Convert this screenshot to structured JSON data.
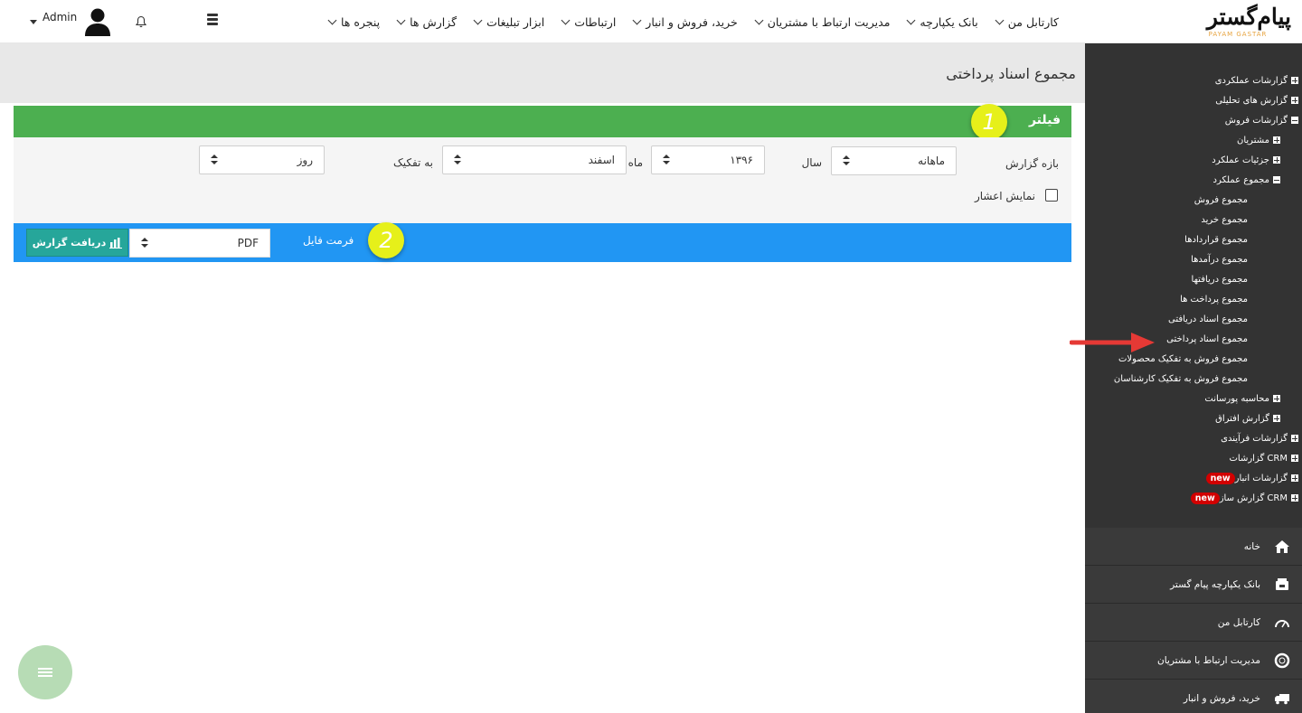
{
  "logo": {
    "main": "پیام‌گستر",
    "sub": "PAYAM GASTAR"
  },
  "nav": [
    {
      "label": "کارتابل من"
    },
    {
      "label": "بانک یکپارچه"
    },
    {
      "label": "مدیریت ارتباط با مشتریان"
    },
    {
      "label": "خرید، فروش و انبار"
    },
    {
      "label": "ارتباطات"
    },
    {
      "label": "ابزار تبلیغات"
    },
    {
      "label": "گزارش ها"
    },
    {
      "label": "پنجره ها"
    }
  ],
  "user": {
    "name": "Admin"
  },
  "page": {
    "title": "مجموع اسناد پرداختی"
  },
  "filter": {
    "title": "فیلتر",
    "callout": "1",
    "period_label": "بازه گزارش",
    "period_value": "ماهانه",
    "year_label": "سال",
    "year_value": "۱۳۹۶",
    "month_label": "ماه",
    "month_value": "اسفند",
    "breakdown_label": "به تفکیک",
    "breakdown_value": "روز",
    "decimals_label": "نمایش اعشار"
  },
  "export": {
    "callout": "2",
    "format_label": "فرمت فایل",
    "format_value": "PDF",
    "download_label": "دریافت گزارش"
  },
  "tree": [
    {
      "label": "گزارشات عملکردی",
      "indent": 0,
      "icon": "plus"
    },
    {
      "label": "گزارش های تحلیلی",
      "indent": 0,
      "icon": "plus"
    },
    {
      "label": "گزارشات فروش",
      "indent": 0,
      "icon": "minus"
    },
    {
      "label": "مشتریان",
      "indent": 1,
      "icon": "plus"
    },
    {
      "label": "جزئیات عملکرد",
      "indent": 1,
      "icon": "plus"
    },
    {
      "label": "مجموع عملکرد",
      "indent": 1,
      "icon": "minus"
    },
    {
      "label": "مجموع فروش",
      "indent": 2,
      "icon": "none"
    },
    {
      "label": "مجموع خرید",
      "indent": 2,
      "icon": "none"
    },
    {
      "label": "مجموع قراردادها",
      "indent": 2,
      "icon": "none"
    },
    {
      "label": "مجموع درآمدها",
      "indent": 2,
      "icon": "none"
    },
    {
      "label": "مجموع دریافتها",
      "indent": 2,
      "icon": "none"
    },
    {
      "label": "مجموع پرداخت ها",
      "indent": 2,
      "icon": "none"
    },
    {
      "label": "مجموع اسناد دریافتی",
      "indent": 2,
      "icon": "none"
    },
    {
      "label": "مجموع اسناد پرداختی",
      "indent": 2,
      "icon": "none"
    },
    {
      "label": "مجموع فروش به تفکیک محصولات",
      "indent": 2,
      "icon": "none"
    },
    {
      "label": "مجموع فروش به تفکیک کارشناسان",
      "indent": 2,
      "icon": "none"
    },
    {
      "label": "محاسبه پورسانت",
      "indent": 1,
      "icon": "plus"
    },
    {
      "label": "گزارش افتراق",
      "indent": 1,
      "icon": "plus"
    },
    {
      "label": "گزارشات فرآیندی",
      "indent": 0,
      "icon": "plus"
    },
    {
      "label": "گزارشات CRM",
      "indent": 0,
      "icon": "plus"
    },
    {
      "label": "گزارشات انبار",
      "indent": 0,
      "icon": "plus",
      "badge": "new"
    },
    {
      "label": "گزارش ساز CRM",
      "indent": 0,
      "icon": "plus",
      "badge": "new"
    }
  ],
  "side_menu": [
    {
      "label": "خانه",
      "icon": "home-icon"
    },
    {
      "label": "بانک یکپارچه پیام گستر",
      "icon": "database-icon"
    },
    {
      "label": "کارتابل من",
      "icon": "dashboard-icon"
    },
    {
      "label": "مدیریت ارتباط با مشتریان",
      "icon": "lifebuoy-icon"
    },
    {
      "label": "خرید، فروش و انبار",
      "icon": "truck-icon"
    }
  ],
  "colors": {
    "filter_header": "#4caf50",
    "export_bar": "#2196f3",
    "download_button": "#26a69a",
    "sidebar": "#333333",
    "callout": "#e6f01a",
    "new_badge": "#d20000",
    "annotation_arrow": "#e53935"
  }
}
